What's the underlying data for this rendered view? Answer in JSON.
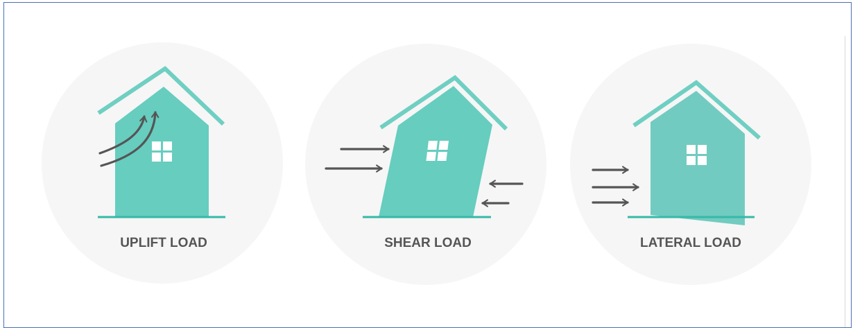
{
  "colors": {
    "house": "#66cdbf",
    "house_lateral": "#72cbc0",
    "roof": "#6fcfc2",
    "ground": "#35b9a7",
    "circle": "#f6f6f6",
    "arrow": "#555555",
    "window": "#ffffff",
    "label": "#555555",
    "frame": "#4a6fb5"
  },
  "panels": [
    {
      "id": "uplift",
      "label": "UPLIFT LOAD",
      "icons": [
        "house-icon",
        "window-icon",
        "uplift-arrow-icon"
      ]
    },
    {
      "id": "shear",
      "label": "SHEAR LOAD",
      "icons": [
        "tilted-house-icon",
        "window-icon",
        "right-arrow-icon",
        "left-arrow-icon"
      ]
    },
    {
      "id": "lateral",
      "label": "LATERAL LOAD",
      "icons": [
        "deformed-house-icon",
        "window-icon",
        "right-arrow-icon"
      ]
    }
  ]
}
